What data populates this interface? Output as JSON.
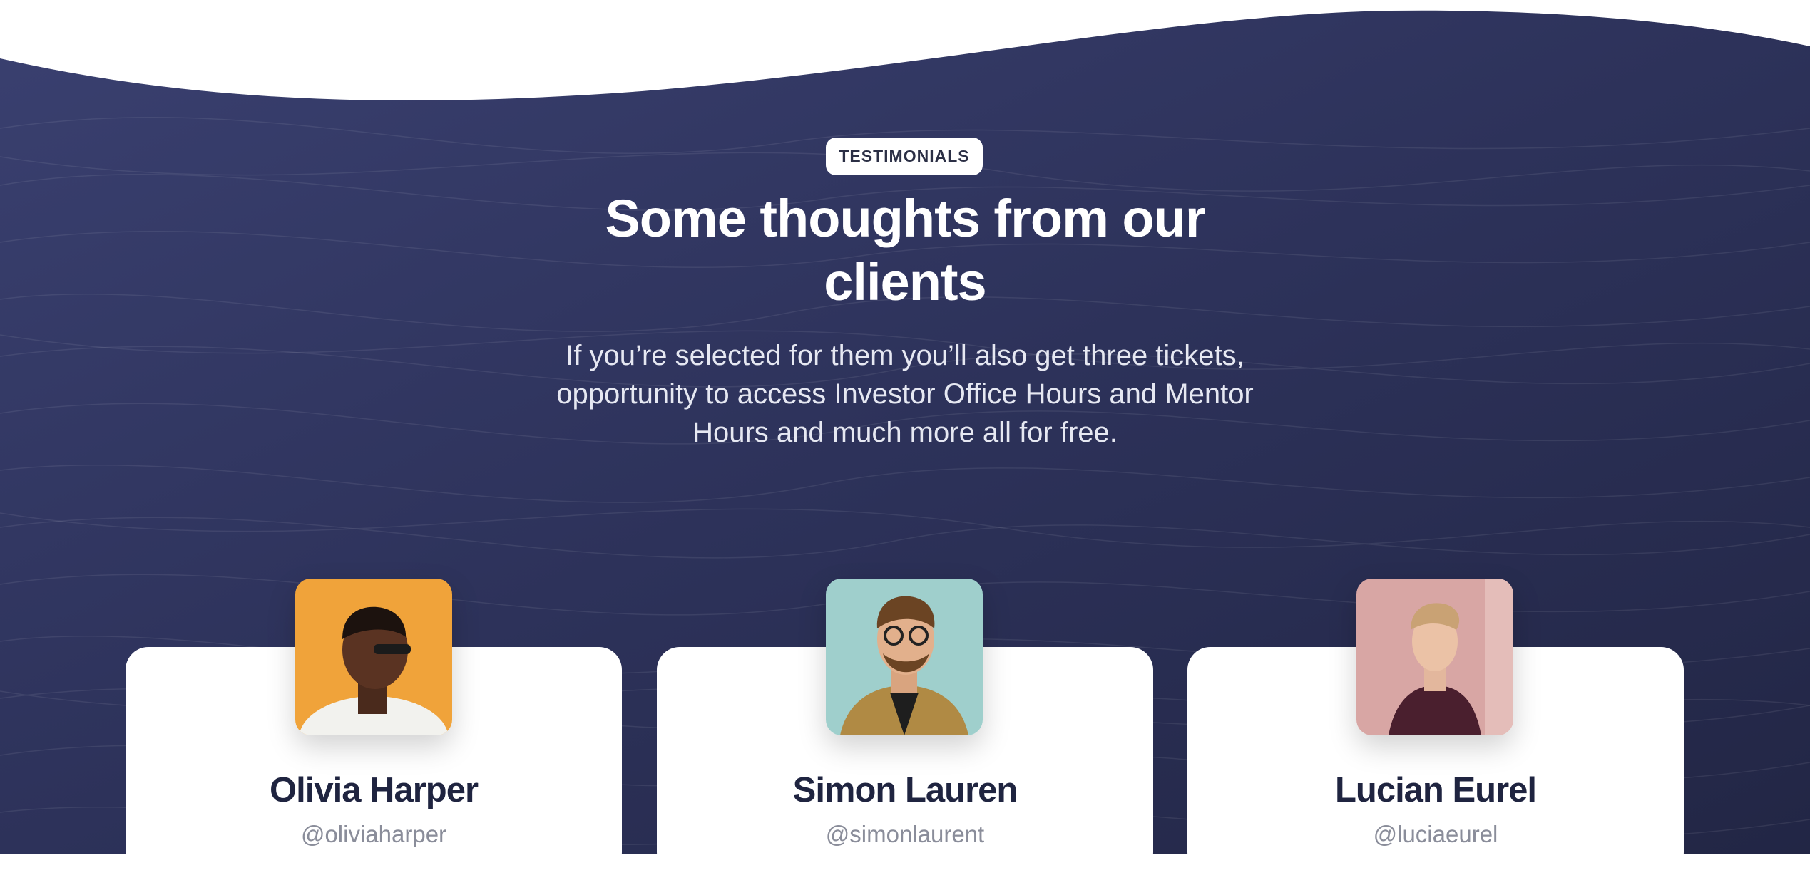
{
  "section": {
    "badge": "TESTIMONIALS",
    "title_line1": "Some thoughts from our",
    "title_line2": "clients",
    "subtitle_line1": "If you’re selected for them you’ll also get three tickets,",
    "subtitle_line2": "opportunity to access Investor Office Hours and Mentor",
    "subtitle_line3": "Hours and much more all for free."
  },
  "colors": {
    "background_dark": "#2c3158",
    "card": "#ffffff",
    "name_text": "#1f2440",
    "handle_text": "#8a8d9a"
  },
  "testimonials": [
    {
      "name": "Olivia Harper",
      "handle": "@oliviaharper",
      "avatar_bg": "#f0a33a"
    },
    {
      "name": "Simon Lauren",
      "handle": "@simonlaurent",
      "avatar_bg": "#9fcfcc"
    },
    {
      "name": "Lucian Eurel",
      "handle": "@luciaeurel",
      "avatar_bg": "#d8a6a4"
    }
  ]
}
